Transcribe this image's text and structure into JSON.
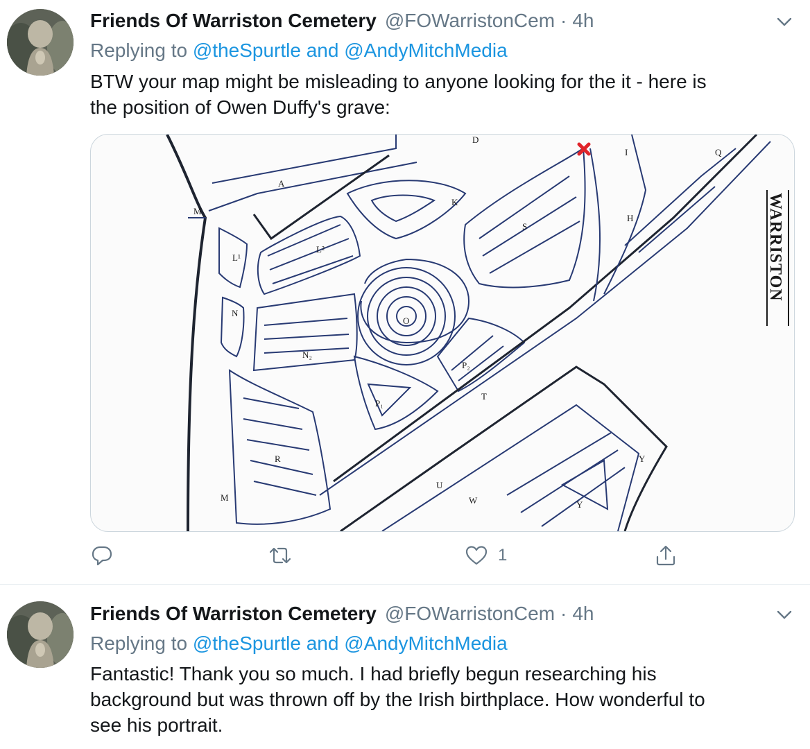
{
  "tweets": [
    {
      "author_name": "Friends Of Warriston Cemetery",
      "handle": "@FOWarristonCem",
      "separator": "·",
      "time": "4h",
      "replying_prefix": "Replying to",
      "reply_mention_1": "@theSpurtle",
      "reply_and": "and",
      "reply_mention_2": "@AndyMitchMedia",
      "text_line1": "BTW your map might be misleading to anyone looking for the it - here is",
      "text_line2": "the position of Owen Duffy's grave:",
      "likes": "1",
      "icons": [
        "avatar-statue",
        "chevron-down-icon",
        "reply-icon",
        "retweet-icon",
        "like-icon",
        "share-icon"
      ]
    },
    {
      "author_name": "Friends Of Warriston Cemetery",
      "handle": "@FOWarristonCem",
      "separator": "·",
      "time": "4h",
      "replying_prefix": "Replying to",
      "reply_mention_1": "@theSpurtle",
      "reply_and": "and",
      "reply_mention_2": "@AndyMitchMedia",
      "text_line1": "Fantastic! Thank you so much. I had briefly begun researching his",
      "text_line2": "background but was thrown off by the Irish birthplace. How wonderful to",
      "text_line3": "see his portrait."
    }
  ],
  "map": {
    "section_labels": [
      "A",
      "D",
      "I",
      "Q",
      "K",
      "M",
      "S",
      "H",
      "L²",
      "L¹",
      "N",
      "O",
      "N₂",
      "P₂",
      "P₁",
      "T",
      "R",
      "M",
      "U",
      "W",
      "Y",
      "Y"
    ],
    "street_label": "WARRISTON",
    "marker_color": "#e0252b"
  },
  "colors": {
    "accent": "#1b95e0",
    "muted": "#657786",
    "text": "#14171a",
    "border": "#e6ecf0"
  }
}
